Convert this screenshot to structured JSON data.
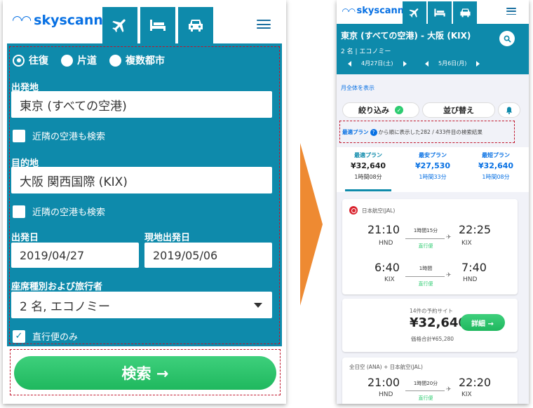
{
  "left": {
    "logo_text": "skyscanner",
    "trip_types": [
      "往復",
      "片道",
      "複数都市"
    ],
    "origin_label": "出発地",
    "origin_value": "東京 (すべての空港)",
    "nearby_origin": "近隣の空港も検索",
    "destination_label": "目的地",
    "destination_value": "大阪 関西国際 (KIX)",
    "nearby_destination": "近隣の空港も検索",
    "depart_label": "出発日",
    "depart_value": "2019/04/27",
    "return_label": "現地出発日",
    "return_value": "2019/05/06",
    "cabin_label": "座席種別および旅行者",
    "cabin_value": "2 名, エコノミー",
    "direct_only": "直行便のみ",
    "search_button": "検索 →"
  },
  "right": {
    "logo_text": "skyscanner",
    "route": "東京 (すべての空港) - 大阪 (KIX)",
    "passengers": "2 名",
    "cabin": "エコノミー",
    "out_date": "4月27日(土)",
    "ret_date": "5月6日(月)",
    "month_link": "月全体を表示",
    "filter_button": "絞り込み",
    "sort_button": "並び替え",
    "info_link": "最適プラン",
    "info_text": "から順に表示した282 / 433件目の検索結果",
    "sort_tabs": [
      {
        "title": "最適プラン",
        "price": "¥32,640",
        "duration": "1時間08分"
      },
      {
        "title": "最安プラン",
        "price": "¥27,530",
        "duration": "1時間33分"
      },
      {
        "title": "最短プラン",
        "price": "¥32,640",
        "duration": "1時間08分"
      }
    ],
    "card1": {
      "airline": "日本航空(JAL)",
      "leg1": {
        "dep": "21:10",
        "dep_ap": "HND",
        "dur": "1時間15分",
        "type": "直行便",
        "arr": "22:25",
        "arr_ap": "KIX"
      },
      "leg2": {
        "dep": "6:40",
        "dep_ap": "KIX",
        "dur": "1時間",
        "type": "直行便",
        "arr": "7:40",
        "arr_ap": "HND"
      }
    },
    "price_card": {
      "sites": "14件の予約サイト",
      "price": "¥32,640",
      "total": "価格合計¥65,280",
      "detail_button": "詳細 →"
    },
    "card2": {
      "airline": "全日空 (ANA) + 日本航空(JAL)",
      "leg1": {
        "dep": "21:00",
        "dep_ap": "HND",
        "dur": "1時間20分",
        "type": "直行便",
        "arr": "22:20",
        "arr_ap": "KIX"
      }
    }
  },
  "colors": {
    "teal": "#0e8aab",
    "brand_blue": "#0770e3",
    "green": "#2ecc71",
    "annotation_red": "#c0152b",
    "arrow_orange": "#ee8a32"
  }
}
